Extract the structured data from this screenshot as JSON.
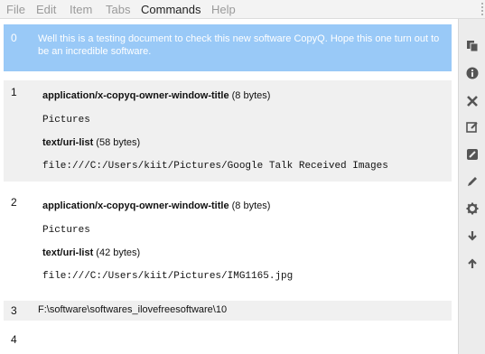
{
  "menu": {
    "file": "File",
    "edit": "Edit",
    "item": "Item",
    "tabs": "Tabs",
    "commands": "Commands",
    "help": "Help"
  },
  "items": [
    {
      "index": "0",
      "text": "Well this is a testing document to check this new software CopyQ. Hope this one turn out to be an incredible software."
    },
    {
      "index": "1",
      "formats": [
        {
          "mime": "application/x-copyq-owner-window-title",
          "size": "(8 bytes)",
          "content": "Pictures"
        },
        {
          "mime": "text/uri-list",
          "size": "(58 bytes)",
          "content": "file:///C:/Users/kiit/Pictures/Google Talk Received Images"
        }
      ]
    },
    {
      "index": "2",
      "formats": [
        {
          "mime": "application/x-copyq-owner-window-title",
          "size": "(8 bytes)",
          "content": "Pictures"
        },
        {
          "mime": "text/uri-list",
          "size": "(42 bytes)",
          "content": "file:///C:/Users/kiit/Pictures/IMG1165.jpg"
        }
      ]
    },
    {
      "index": "3",
      "text": "F:\\software\\softwares_ilovefreesoftware\\10"
    },
    {
      "index": "4",
      "text": ""
    }
  ],
  "sidebar_icons": [
    "copy-icon",
    "info-icon",
    "remove-icon",
    "edit-icon",
    "edit-external-icon",
    "pen-icon",
    "gear-icon",
    "arrow-down-icon",
    "arrow-up-icon"
  ]
}
